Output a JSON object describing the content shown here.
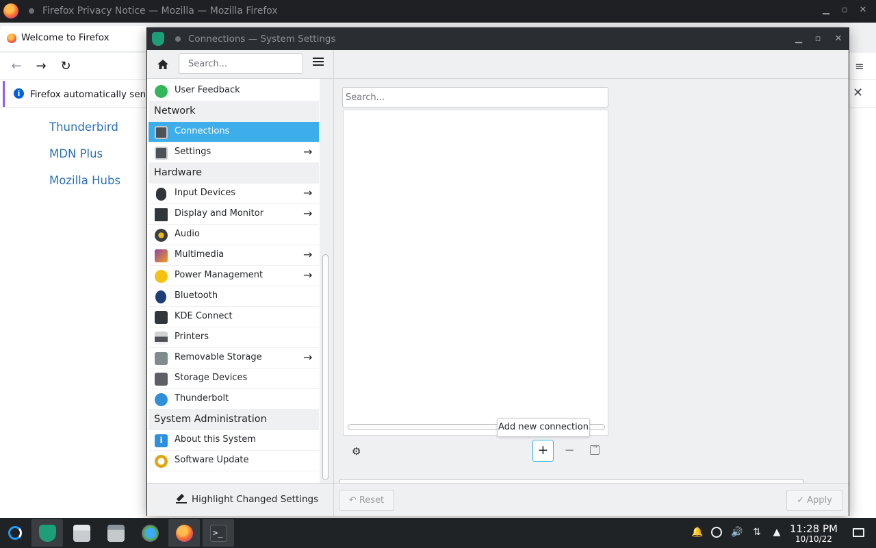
{
  "firefox": {
    "window_title": "Firefox Privacy Notice — Mozilla — Mozilla Firefox",
    "tab_label": "Welcome to Firefox",
    "notification": "Firefox automatically sends",
    "links": [
      "Thunderbird",
      "MDN Plus",
      "Mozilla Hubs"
    ]
  },
  "settings": {
    "window_title": "Connections — System Settings",
    "search_placeholder": "Search...",
    "highlight_label": "Highlight Changed Settings",
    "sidebar": {
      "user_feedback": "User Feedback",
      "cat_network": "Network",
      "connections": "Connections",
      "settings": "Settings",
      "cat_hardware": "Hardware",
      "input_devices": "Input Devices",
      "display_monitor": "Display and Monitor",
      "audio": "Audio",
      "multimedia": "Multimedia",
      "power_management": "Power Management",
      "bluetooth": "Bluetooth",
      "kde_connect": "KDE Connect",
      "printers": "Printers",
      "removable_storage": "Removable Storage",
      "storage_devices": "Storage Devices",
      "thunderbolt": "Thunderbolt",
      "cat_sysadmin": "System Administration",
      "about_system": "About this System",
      "software_update": "Software Update"
    },
    "main": {
      "search_placeholder": "Search...",
      "tooltip": "Add new connection",
      "add_symbol": "+",
      "remove_symbol": "−",
      "reset_label": "Reset",
      "apply_label": "Apply"
    }
  },
  "taskbar": {
    "time": "11:28 PM",
    "date": "10/10/22"
  },
  "colors": {
    "selection": "#3daee9",
    "titlebar": "#2a2e32",
    "taskbar": "#202326"
  }
}
